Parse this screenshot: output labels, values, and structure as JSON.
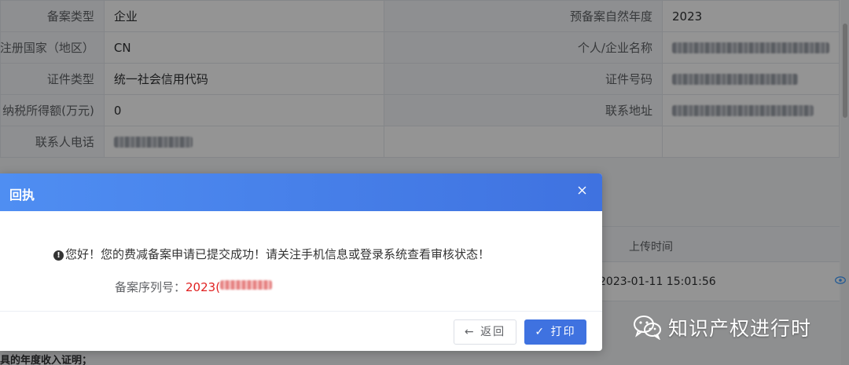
{
  "info_table": {
    "rows": [
      {
        "label_left": "备案类型",
        "value_left": "企业",
        "label_right": "预备案自然年度",
        "value_right": "2023"
      },
      {
        "label_left": "注册国家（地区）",
        "value_left": "CN",
        "label_right": "个人/企业名称",
        "value_right": ""
      },
      {
        "label_left": "证件类型",
        "value_left": "统一社会信用代码",
        "label_right": "证件号码",
        "value_right": ""
      },
      {
        "label_left": "纳税所得额(万元)",
        "value_left": "0",
        "label_right": "联系地址",
        "value_right": ""
      },
      {
        "label_left": "联系人电话",
        "value_left": "",
        "label_right": "",
        "value_right": ""
      }
    ]
  },
  "upload_table": {
    "header_upload_time": "上传时间",
    "row_upload_time": "2023-01-11 15:01:56",
    "view_icon": "eye-icon"
  },
  "bottom_note": "具的年度收入证明；",
  "dialog": {
    "title": "回执",
    "close_icon": "close-icon",
    "warn_icon_glyph": "!",
    "message": "您好！您的费减备案申请已提交成功！请关注手机信息或登录系统查看审核状态！",
    "serial_label": "备案序列号：",
    "serial_value_visible": "2023(",
    "back_button": "← 返回",
    "print_button": "✓ 打印"
  },
  "watermark": {
    "text": "知识产权进行时",
    "logo_icon": "wechat-logo-icon"
  },
  "colors": {
    "header_gradient_start": "#4f8ef2",
    "header_gradient_end": "#3f72e0",
    "primary_button": "#3f72e0",
    "serial_red": "#e02020"
  }
}
